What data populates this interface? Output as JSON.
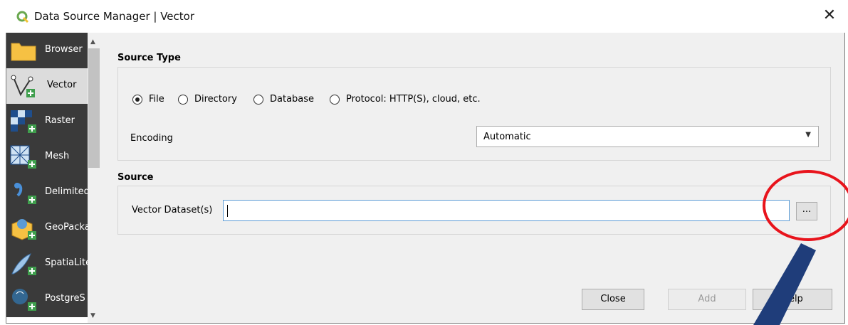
{
  "window": {
    "title": "Data Source Manager | Vector",
    "close_glyph": "✕"
  },
  "sidebar": {
    "items": [
      {
        "label": "Browser",
        "icon": "folder-icon"
      },
      {
        "label": "Vector",
        "icon": "vector-icon",
        "active": true
      },
      {
        "label": "Raster",
        "icon": "raster-icon"
      },
      {
        "label": "Mesh",
        "icon": "mesh-icon"
      },
      {
        "label": "Delimited",
        "icon": "delimited-text-icon"
      },
      {
        "label": "GeoPacka",
        "icon": "geopackage-icon"
      },
      {
        "label": "SpatiaLite",
        "icon": "spatialite-icon"
      },
      {
        "label": "PostgreS",
        "icon": "postgresql-icon"
      }
    ]
  },
  "source_type": {
    "heading": "Source Type",
    "options": [
      "File",
      "Directory",
      "Database",
      "Protocol: HTTP(S), cloud, etc."
    ],
    "selected": "File",
    "encoding_label": "Encoding",
    "encoding_value": "Automatic"
  },
  "source": {
    "heading": "Source",
    "dataset_label": "Vector Dataset(s)",
    "dataset_value": "",
    "browse_label": "..."
  },
  "buttons": {
    "close": "Close",
    "add": "Add",
    "help": "Help"
  },
  "colors": {
    "annotation_circle": "#e8141c",
    "annotation_arrow": "#1f3d7a",
    "accent": "#5b9bd5"
  }
}
